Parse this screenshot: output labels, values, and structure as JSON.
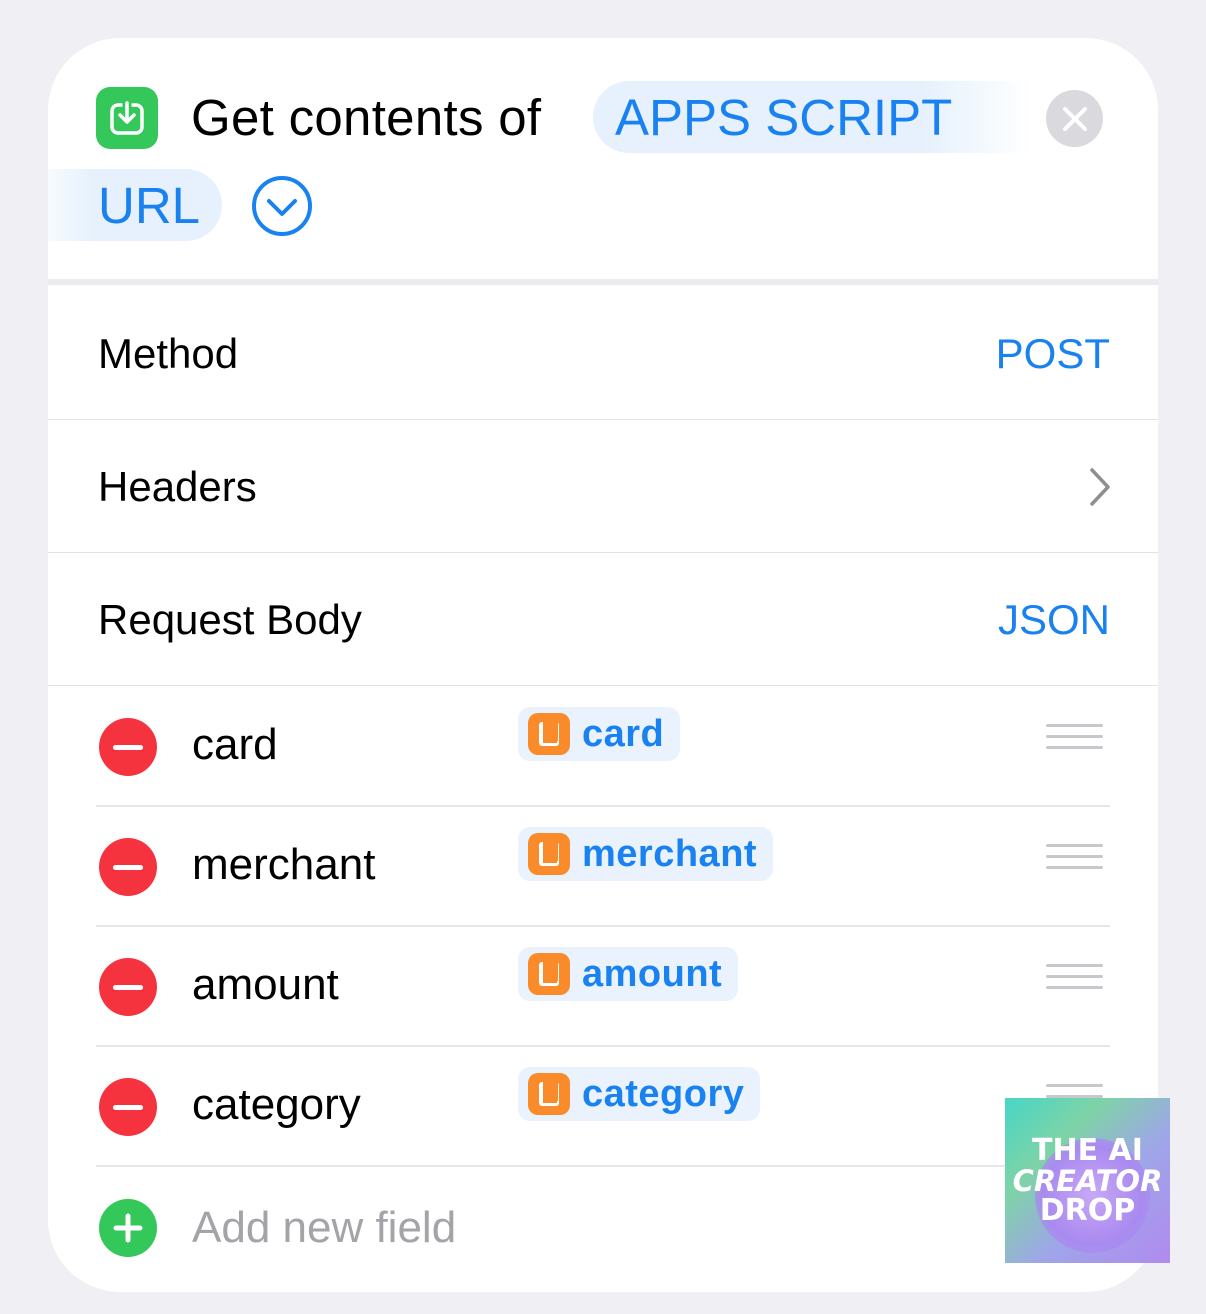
{
  "header": {
    "title": "Get contents of",
    "token_line1": "APPS SCRIPT",
    "token_line2": "URL",
    "action_icon": "download-icon",
    "colors": {
      "accent": "#1a82f0",
      "action_green": "#34c759"
    }
  },
  "rows": {
    "method": {
      "label": "Method",
      "value": "POST"
    },
    "headers": {
      "label": "Headers"
    },
    "request_body": {
      "label": "Request Body",
      "value": "JSON"
    }
  },
  "fields": [
    {
      "key": "card",
      "value": "card"
    },
    {
      "key": "merchant",
      "value": "merchant"
    },
    {
      "key": "amount",
      "value": "amount"
    },
    {
      "key": "category",
      "value": "category"
    }
  ],
  "add_field": {
    "label": "Add new field"
  },
  "watermark": {
    "line1": "THE AI",
    "line2": "CREATOR",
    "line3": "DROP"
  }
}
